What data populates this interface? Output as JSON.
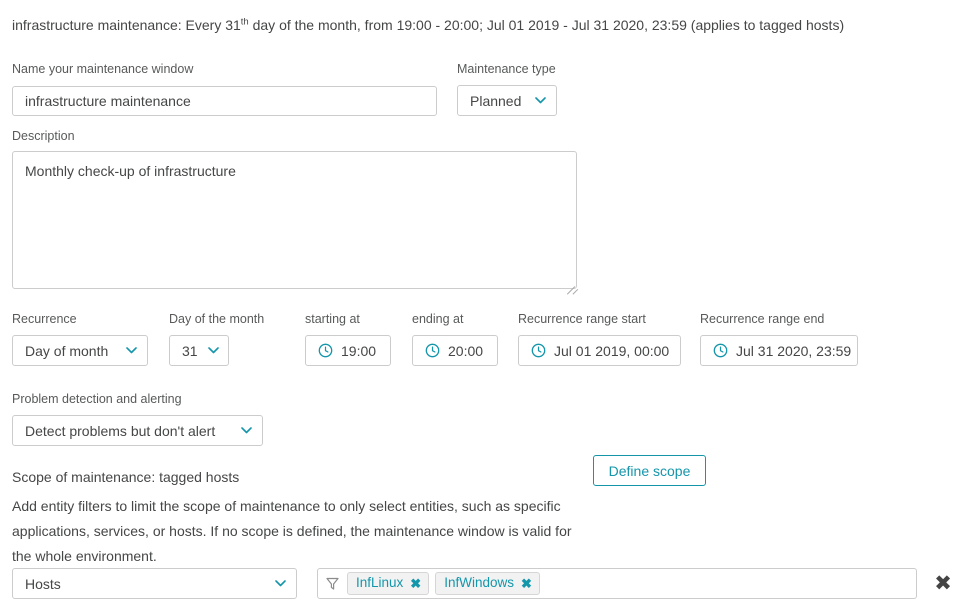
{
  "summary": {
    "prefix": "infrastructure maintenance: Every 31",
    "ordinal_suffix": "th",
    "rest": " day of the month, from 19:00 - 20:00; Jul 01 2019 - Jul 31 2020, 23:59 (applies to tagged hosts)"
  },
  "fields": {
    "name": {
      "label": "Name your maintenance window",
      "value": "infrastructure maintenance",
      "placeholder": "Name your maintenance window"
    },
    "maintenance_type": {
      "label": "Maintenance type",
      "value": "Planned"
    },
    "description": {
      "label": "Description",
      "value": "Monthly check-up of infrastructure",
      "placeholder": "Description"
    },
    "recurrence": {
      "label": "Recurrence",
      "value": "Day of month"
    },
    "day_of_month": {
      "label": "Day of the month",
      "value": "31"
    },
    "starting_at": {
      "label": "starting at",
      "value": "19:00",
      "icon": "clock-icon"
    },
    "ending_at": {
      "label": "ending at",
      "value": "20:00",
      "icon": "clock-icon"
    },
    "range_start": {
      "label": "Recurrence range start",
      "value": "Jul 01 2019, 00:00",
      "icon": "clock-icon"
    },
    "range_end": {
      "label": "Recurrence range end",
      "value": "Jul 31 2020, 23:59",
      "icon": "clock-icon"
    },
    "problem_detection": {
      "label": "Problem detection and alerting",
      "value": "Detect problems but don't alert"
    }
  },
  "scope": {
    "title": "Scope of maintenance: tagged hosts",
    "description": "Add entity filters to limit the scope of maintenance to only select entities, such as specific applications, services, or hosts. If no scope is defined, the maintenance window is valid for the whole environment.",
    "define_button": "Define scope"
  },
  "filter_row": {
    "entity_type": "Hosts",
    "filter_icon": "funnel-icon",
    "tags": [
      {
        "label": "InfLinux",
        "remove": "✖"
      },
      {
        "label": "InfWindows",
        "remove": "✖"
      }
    ],
    "remove_row": "✖"
  },
  "colors": {
    "accent": "#1496ab",
    "text": "#454646",
    "label": "#585a5a",
    "border": "#cccccc",
    "tag_bg": "#f2f2f2"
  }
}
